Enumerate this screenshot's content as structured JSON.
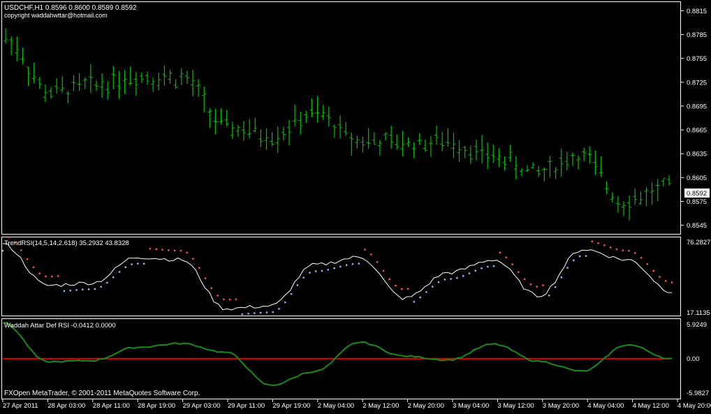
{
  "colors": {
    "background": "#000000",
    "frame": "#ffffff",
    "bars": "#00c000",
    "rsi_line": "#ffffff",
    "dots_bear": "#ff5a4e",
    "dots_bull": "#9fb4ff",
    "def_line": "#1b8a1b",
    "zero_line": "#e00000",
    "text": "#ffffff"
  },
  "main": {
    "symbol_line": "USDCHF,H1  0.8596 0.8600 0.8589 0.8592",
    "copyright": "copyright waddahwttar@hotmail.com",
    "price_labels": [
      "0.8815",
      "0.8785",
      "0.8755",
      "0.8725",
      "0.8695",
      "0.8665",
      "0.8635",
      "0.8605",
      "0.8575",
      "0.8545"
    ],
    "current_price": "0.8592"
  },
  "trendrsi": {
    "label": "TrendRSI(14,5,14,2.618) 35.2932 43.8328",
    "max_label": "76.2827",
    "min_label": "17.1135"
  },
  "waddah": {
    "label": "Waddah Attar Def RSI -0.0412 0.0000",
    "max_label": "5.9249",
    "zero_label": "0.00",
    "min_label": "-5.9827"
  },
  "footer": "FXOpen MetaTrader, © 2001-2011 MetaQuotes Software Corp.",
  "time_labels": [
    "27 Apr 2011",
    "28 Apr 03:00",
    "28 Apr 11:00",
    "28 Apr 19:00",
    "29 Apr 03:00",
    "29 Apr 11:00",
    "29 Apr 19:00",
    "2 May 04:00",
    "2 May 12:00",
    "2 May 20:00",
    "3 May 04:00",
    "3 May 12:00",
    "3 May 20:00",
    "4 May 04:00",
    "4 May 12:00",
    "4 May 20:00"
  ],
  "chart_data": [
    {
      "type": "ohlc",
      "title": "USDCHF,H1",
      "ylim": [
        0.8535,
        0.8825
      ],
      "x": [
        "27 Apr 2011",
        "28 Apr 03:00",
        "28 Apr 11:00",
        "28 Apr 19:00",
        "29 Apr 03:00",
        "29 Apr 11:00",
        "29 Apr 19:00",
        "2 May 04:00",
        "2 May 12:00",
        "2 May 20:00",
        "3 May 04:00",
        "3 May 12:00",
        "3 May 20:00",
        "4 May 04:00",
        "4 May 12:00",
        "4 May 20:00"
      ],
      "series": [
        {
          "values": [
            0.878,
            0.8712,
            0.8722,
            0.8733,
            0.873,
            0.8668,
            0.8658,
            0.8685,
            0.8652,
            0.8648,
            0.865,
            0.8632,
            0.8612,
            0.8632,
            0.8575,
            0.8592
          ]
        }
      ]
    },
    {
      "type": "line",
      "title": "TrendRSI(14,5,14,2.618)",
      "ylim": [
        17.1135,
        76.2827
      ],
      "x": [
        "27 Apr 2011",
        "28 Apr 03:00",
        "28 Apr 11:00",
        "28 Apr 19:00",
        "29 Apr 03:00",
        "29 Apr 11:00",
        "29 Apr 19:00",
        "2 May 04:00",
        "2 May 12:00",
        "2 May 20:00",
        "3 May 04:00",
        "3 May 12:00",
        "3 May 20:00",
        "4 May 04:00",
        "4 May 12:00",
        "4 May 20:00"
      ],
      "series": [
        {
          "values": [
            72,
            40,
            42,
            62,
            60,
            22,
            24,
            56,
            62,
            30,
            50,
            60,
            32,
            68,
            60,
            35.29
          ]
        }
      ]
    },
    {
      "type": "line",
      "title": "Waddah Attar Def RSI",
      "ylim": [
        -5.9827,
        5.9249
      ],
      "x": [
        "27 Apr 2011",
        "28 Apr 03:00",
        "28 Apr 11:00",
        "28 Apr 19:00",
        "29 Apr 03:00",
        "29 Apr 11:00",
        "29 Apr 19:00",
        "2 May 04:00",
        "2 May 12:00",
        "2 May 20:00",
        "3 May 04:00",
        "3 May 12:00",
        "3 May 20:00",
        "4 May 04:00",
        "4 May 12:00",
        "4 May 20:00"
      ],
      "series": [
        {
          "values": [
            5.7,
            -0.5,
            -0.3,
            1.8,
            2.4,
            1.0,
            -4.2,
            -2.0,
            2.6,
            0.4,
            -0.2,
            2.3,
            -0.4,
            -2.0,
            2.2,
            -0.04
          ]
        }
      ]
    }
  ]
}
